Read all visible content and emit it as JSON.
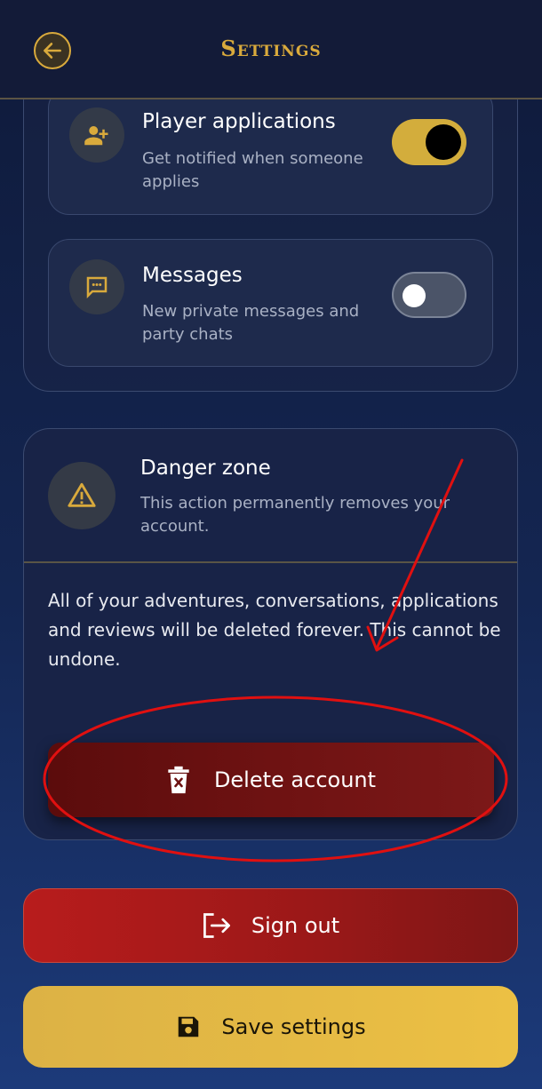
{
  "header": {
    "title": "Settings",
    "back_icon": "arrow-left-icon"
  },
  "notifications": {
    "items": [
      {
        "title": "Player applications",
        "description": "Get notified when someone applies",
        "icon": "person-add-icon",
        "enabled": true
      },
      {
        "title": "Messages",
        "description": "New private messages and party chats",
        "icon": "chat-bubble-icon",
        "enabled": false
      }
    ]
  },
  "danger_zone": {
    "title": "Danger zone",
    "subtitle": "This action permanently removes your account.",
    "body": "All of your adventures, conversations, applications and reviews will be deleted forever. This cannot be undone.",
    "icon": "warning-icon",
    "delete_label": "Delete account",
    "delete_icon": "trash-x-icon"
  },
  "actions": {
    "sign_out_label": "Sign out",
    "sign_out_icon": "logout-icon",
    "save_label": "Save settings",
    "save_icon": "save-icon"
  },
  "colors": {
    "accent_gold": "#d9aa3c",
    "danger_red": "#b81c1c",
    "background": "#142652"
  }
}
